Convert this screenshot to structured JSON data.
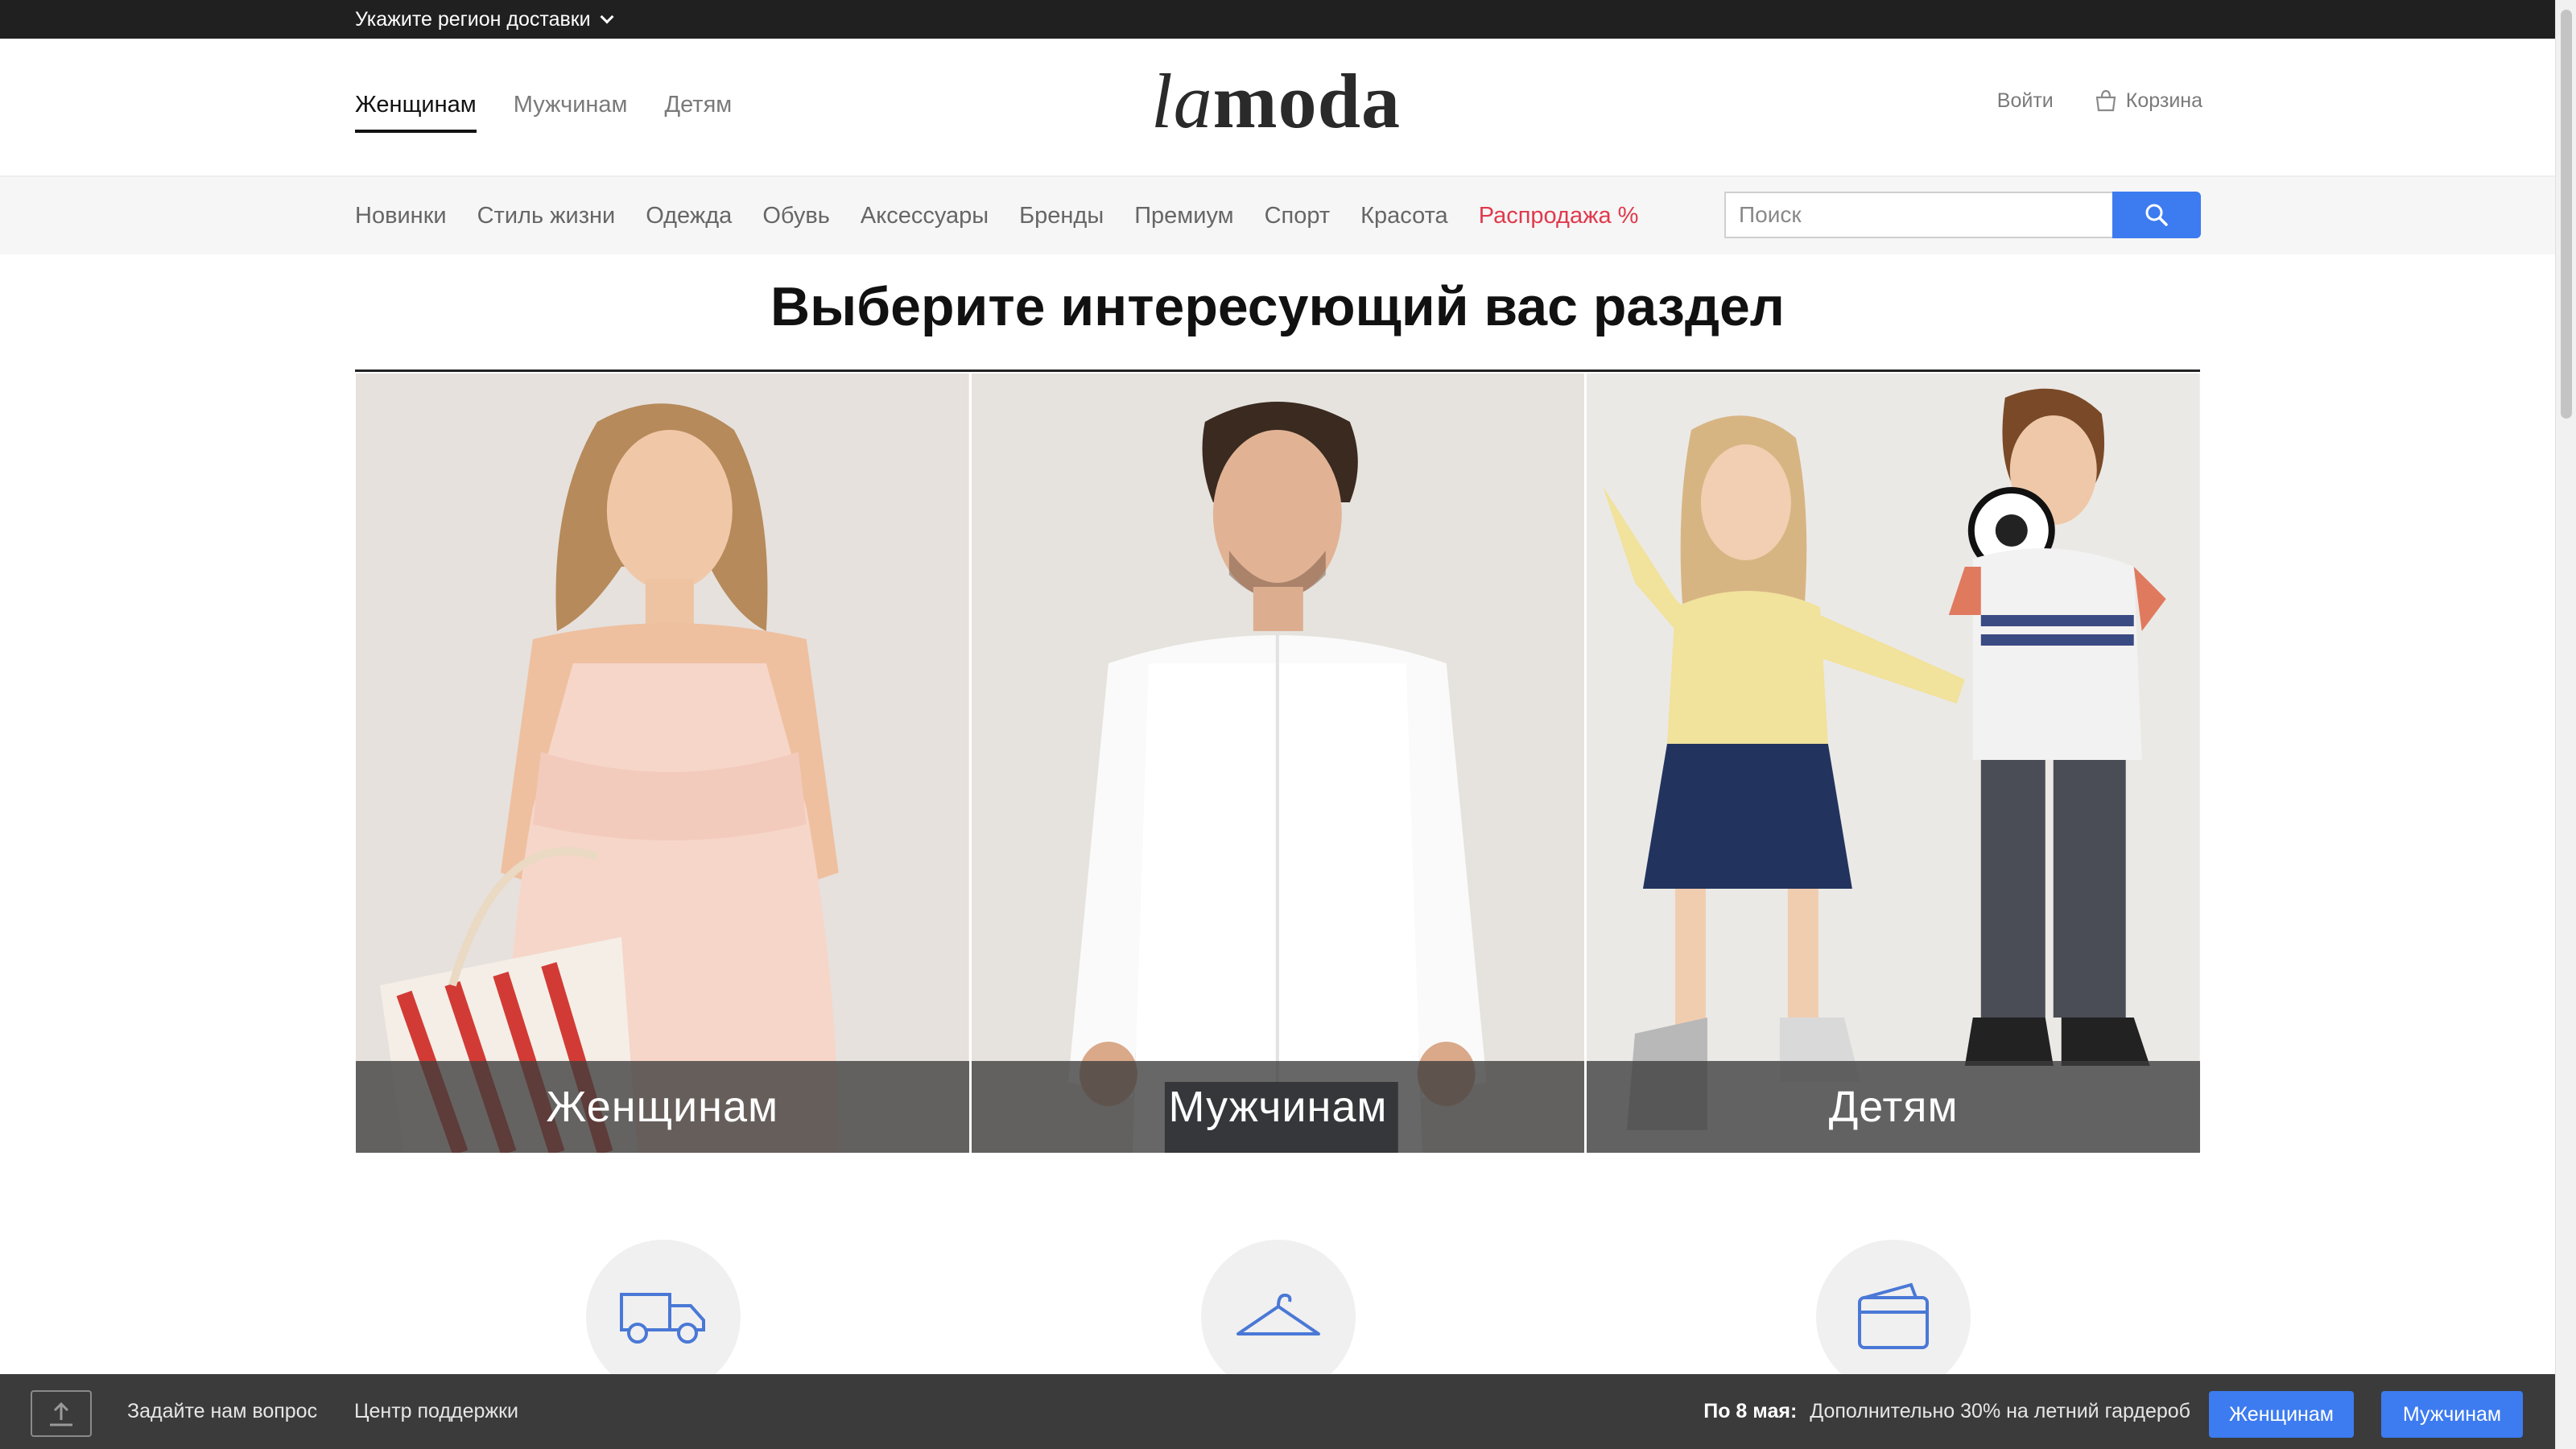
{
  "region_bar": {
    "label": "Укажите регион доставки"
  },
  "header": {
    "gender_tabs": [
      {
        "label": "Женщинам",
        "active": true
      },
      {
        "label": "Мужчинам",
        "active": false
      },
      {
        "label": "Детям",
        "active": false
      }
    ],
    "logo": {
      "part1": "la",
      "part2": "moda"
    },
    "login_label": "Войти",
    "cart_label": "Корзина"
  },
  "category_nav": {
    "items": [
      {
        "label": "Новинки"
      },
      {
        "label": "Стиль жизни"
      },
      {
        "label": "Одежда"
      },
      {
        "label": "Обувь"
      },
      {
        "label": "Аксессуары"
      },
      {
        "label": "Бренды"
      },
      {
        "label": "Премиум"
      },
      {
        "label": "Спорт"
      },
      {
        "label": "Красота"
      },
      {
        "label": "Распродажа %",
        "highlight": true
      }
    ],
    "search_placeholder": "Поиск"
  },
  "main": {
    "heading": "Выберите интересующий вас раздел",
    "cards": [
      {
        "label": "Женщинам"
      },
      {
        "label": "Мужчинам"
      },
      {
        "label": "Детям"
      }
    ],
    "features": [
      {
        "icon": "truck-icon"
      },
      {
        "icon": "hanger-icon"
      },
      {
        "icon": "wallet-icon"
      }
    ]
  },
  "bottom_bar": {
    "ask_label": "Задайте нам вопрос",
    "support_label": "Центр поддержки",
    "promo_date": "По 8 мая:",
    "promo_text": "Дополнительно 30% на летний гардероб",
    "btn_women": "Женщинам",
    "btn_men": "Мужчинам"
  },
  "colors": {
    "accent": "#3d7bf0",
    "sale": "#e0394c",
    "topbar": "#202020",
    "bottombar": "#3b3b3b"
  }
}
